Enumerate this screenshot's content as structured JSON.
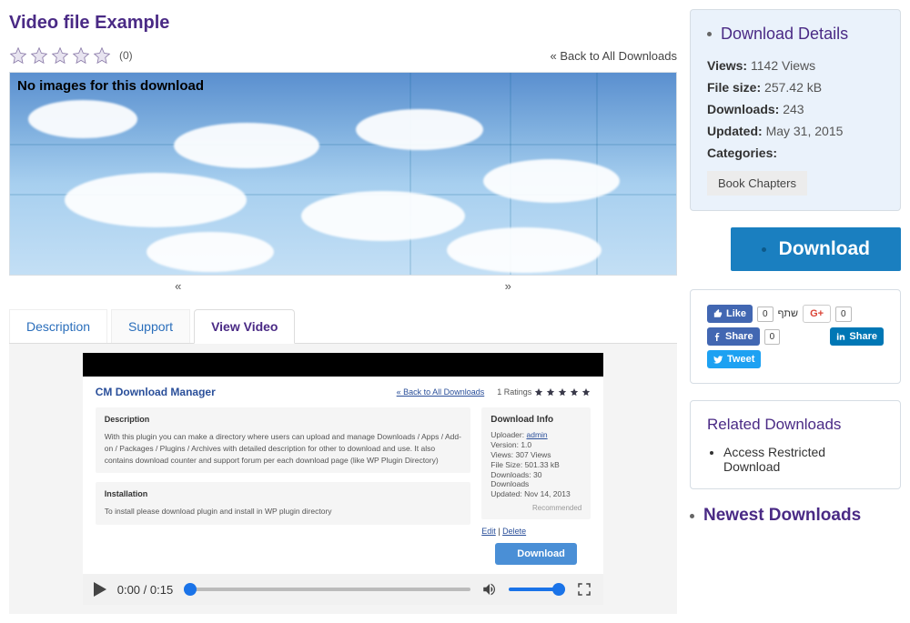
{
  "title": "Video file Example",
  "rating_count": "(0)",
  "back_link": "« Back to All Downloads",
  "hero_text": "No images for this download",
  "nav_prev": "«",
  "nav_next": "»",
  "tabs": {
    "description": "Description",
    "support": "Support",
    "view_video": "View Video"
  },
  "inner": {
    "title": "CM Download Manager",
    "back": "« Back to All Downloads",
    "ratings_label": "1 Ratings",
    "desc_h": "Description",
    "desc_p": "With this plugin you can make a directory where users can upload and manage Downloads / Apps / Add-on / Packages / Plugins / Archives with detailed description for other to download and use. It also contains download counter and support forum per each download page (like WP Plugin Directory)",
    "install_h": "Installation",
    "install_p": "To install please download plugin and install in WP plugin directory",
    "info_h": "Download Info",
    "uploader_label": "Uploader:",
    "uploader": "admin",
    "version": "Version: 1.0",
    "views": "Views: 307 Views",
    "filesize": "File Size: 501.33 kB",
    "downloads": "Downloads: 30 Downloads",
    "updated": "Updated: Nov 14, 2013",
    "recommended": "Recommended",
    "edit": "Edit",
    "delete": "Delete",
    "dl_btn": "Download"
  },
  "player": {
    "time": "0:00 / 0:15"
  },
  "details": {
    "heading": "Download Details",
    "views_label": "Views:",
    "views": "1142 Views",
    "filesize_label": "File size:",
    "filesize": "257.42 kB",
    "downloads_label": "Downloads:",
    "downloads": "243",
    "updated_label": "Updated:",
    "updated": "May 31, 2015",
    "categories_label": "Categories:",
    "category": "Book Chapters"
  },
  "download_btn": "Download",
  "social": {
    "like": "Like",
    "like_count": "0",
    "he": "שתף",
    "gplus_count": "0",
    "share": "Share",
    "share_count": "0",
    "linkedin": "Share",
    "tweet": "Tweet"
  },
  "related": {
    "heading": "Related Downloads",
    "item": "Access Restricted Download"
  },
  "newest": "Newest Downloads"
}
